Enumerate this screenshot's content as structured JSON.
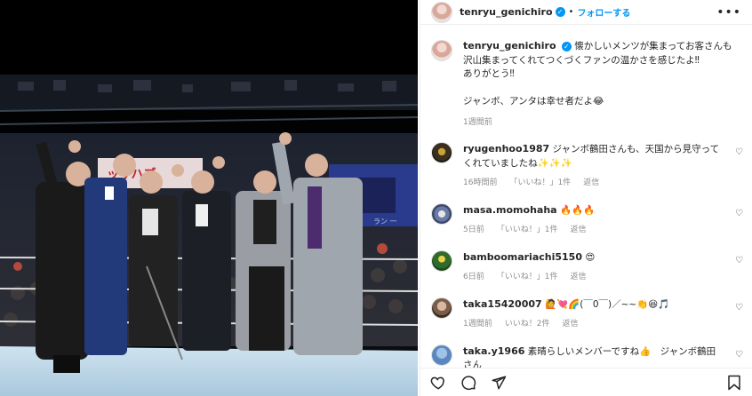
{
  "post": {
    "username": "tenryu_genichiro",
    "follow_label": "フォローする",
    "dot": "•",
    "more": "•••"
  },
  "caption": {
    "username": "tenryu_genichiro",
    "text": "懐かしいメンツが集まってお客さんも沢山集まってくれてつくづくファンの温かさを感じたよ‼︎\nありがとう‼︎\n\nジャンボ、アンタは幸せ者だよ😂",
    "time": "1週間前"
  },
  "comments": [
    {
      "username": "ryugenhoo1987",
      "text": "ジャンボ鶴田さんも、天国から見守ってくれていましたね✨✨✨",
      "time": "16時間前",
      "likes": "「いいね！」1件",
      "reply": "返信"
    },
    {
      "username": "masa.momohaha",
      "text": "🔥🔥🔥",
      "time": "5日前",
      "likes": "「いいね！」1件",
      "reply": "返信"
    },
    {
      "username": "bamboomariachi5150",
      "text": "😍",
      "time": "6日前",
      "likes": "「いいね！」1件",
      "reply": "返信"
    },
    {
      "username": "taka15420007",
      "text": "🙋💘🌈(￣0￣)／~~👏😆🎵",
      "time": "1週間前",
      "likes": "いいね！2件",
      "reply": "返信"
    },
    {
      "username": "taka.y1966",
      "text": "素晴らしいメンバーですね👍　ジャンボ鶴田さん"
    }
  ],
  "icons": {
    "like": "heart-icon",
    "comment": "comment-icon",
    "share": "share-icon",
    "save": "bookmark-icon",
    "comment_like": "small-heart-icon",
    "verified": "verified-badge-icon"
  },
  "photo": {
    "banner_text": "ッサハブ",
    "screen_text": "ラン 一"
  }
}
